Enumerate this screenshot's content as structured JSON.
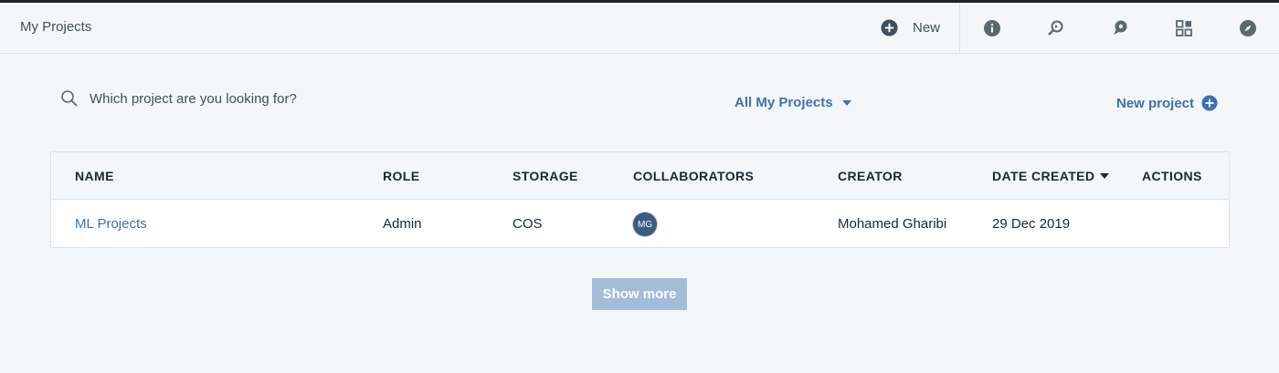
{
  "header": {
    "title": "My Projects",
    "new_label": "New",
    "icons": [
      "info-icon",
      "search-refresh-icon",
      "chat-icon",
      "apps-grid-icon",
      "compass-icon"
    ]
  },
  "toolbar": {
    "search_placeholder": "Which project are you looking for?",
    "filter_label": "All My Projects",
    "new_project_label": "New project"
  },
  "table": {
    "columns": [
      "NAME",
      "ROLE",
      "STORAGE",
      "COLLABORATORS",
      "CREATOR",
      "DATE CREATED",
      "ACTIONS"
    ],
    "sorted_column": "DATE CREATED",
    "rows": [
      {
        "name": "ML Projects",
        "role": "Admin",
        "storage": "COS",
        "collaborator_initials": "MG",
        "creator": "Mohamed Gharibi",
        "date_created": "29 Dec 2019"
      }
    ]
  },
  "show_more_label": "Show more",
  "colors": {
    "accent": "#3d70b2",
    "background": "#f4f7fa",
    "button_disabled": "#a3bdd9",
    "icon": "#5a6872"
  }
}
